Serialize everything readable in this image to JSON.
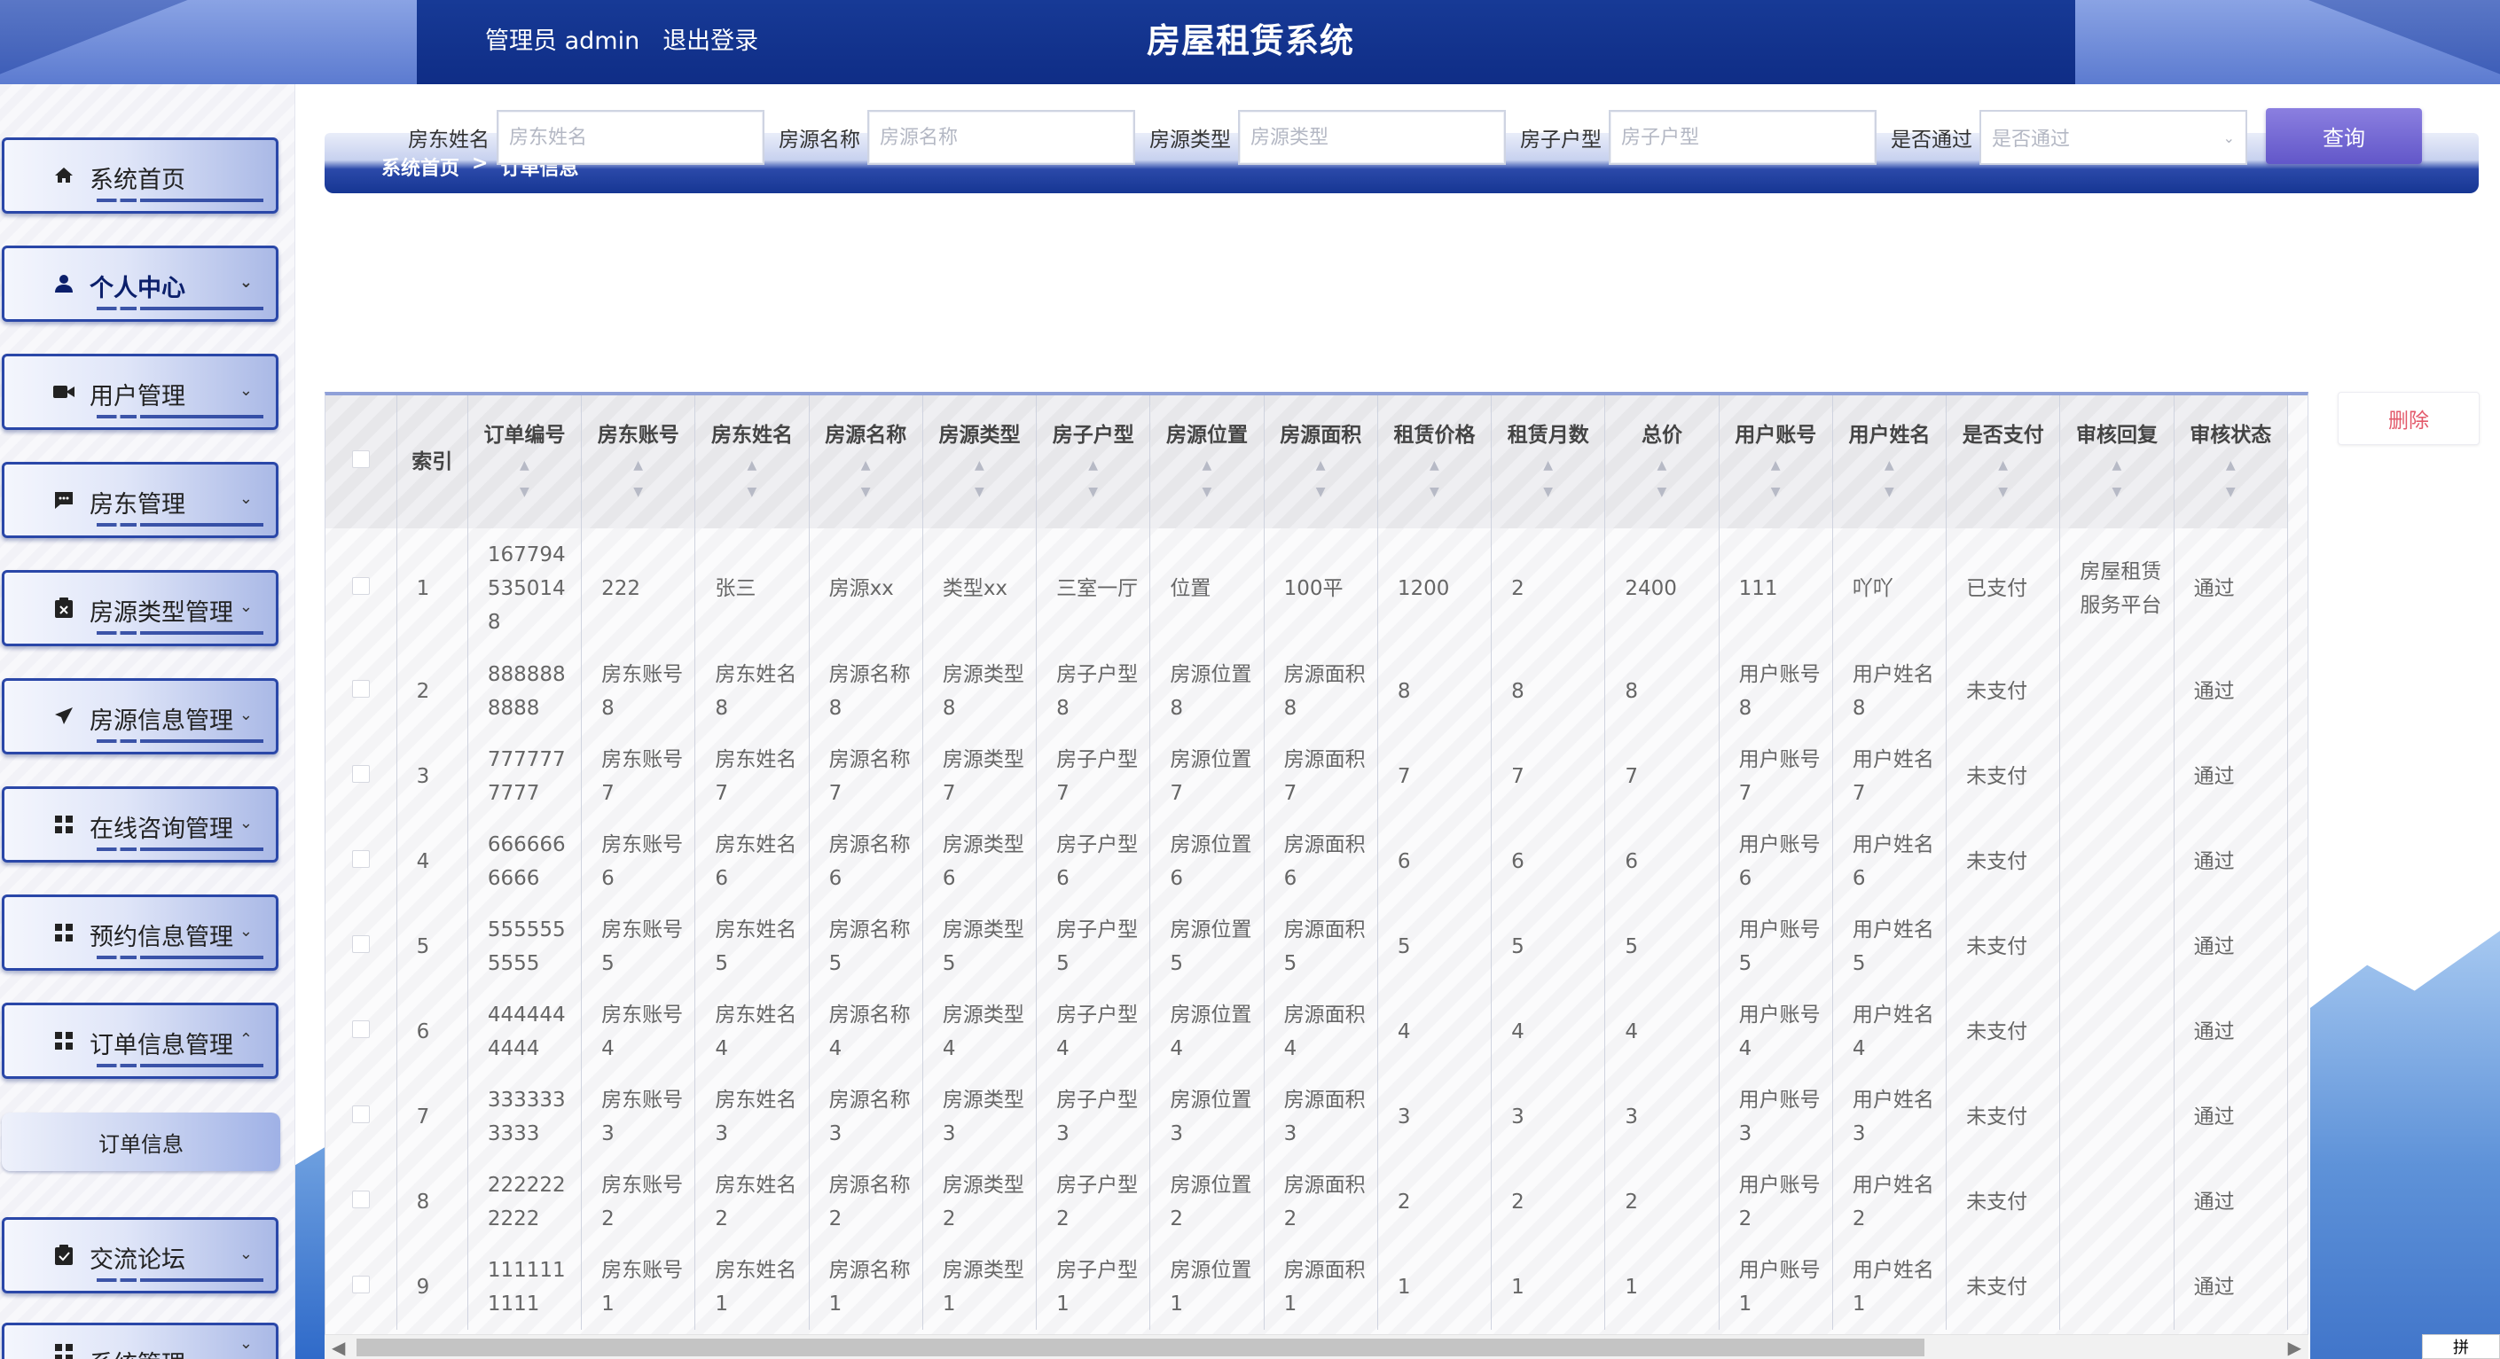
{
  "header": {
    "admin_text": "管理员 admin",
    "logout": "退出登录",
    "title": "房屋租赁系统"
  },
  "sidebar": {
    "items": [
      {
        "label": "系统首页",
        "icon": "home-icon"
      },
      {
        "label": "个人中心",
        "icon": "user-icon"
      },
      {
        "label": "用户管理",
        "icon": "video-icon"
      },
      {
        "label": "房东管理",
        "icon": "chat-icon"
      },
      {
        "label": "房源类型管理",
        "icon": "clipboard-x-icon"
      },
      {
        "label": "房源信息管理",
        "icon": "send-icon"
      },
      {
        "label": "在线咨询管理",
        "icon": "grid-icon"
      },
      {
        "label": "预约信息管理",
        "icon": "grid-icon"
      },
      {
        "label": "订单信息管理",
        "icon": "grid-icon"
      },
      {
        "label": "交流论坛",
        "icon": "clipboard-check-icon"
      },
      {
        "label": "系统管理",
        "icon": "grid-icon"
      }
    ],
    "sub_item": "订单信息"
  },
  "breadcrumb": {
    "home": "系统首页",
    "sep": ">",
    "current": "订单信息"
  },
  "search": {
    "fields": [
      {
        "label": "房东姓名",
        "placeholder": "房东姓名"
      },
      {
        "label": "房源名称",
        "placeholder": "房源名称"
      },
      {
        "label": "房源类型",
        "placeholder": "房源类型"
      },
      {
        "label": "房子户型",
        "placeholder": "房子户型"
      }
    ],
    "select": {
      "label": "是否通过",
      "placeholder": "是否通过"
    },
    "button": "查询"
  },
  "actions": {
    "delete": "删除"
  },
  "table": {
    "headers": [
      "索引",
      "订单编号",
      "房东账号",
      "房东姓名",
      "房源名称",
      "房源类型",
      "房子户型",
      "房源位置",
      "房源面积",
      "租赁价格",
      "租赁月数",
      "总价",
      "用户账号",
      "用户姓名",
      "是否支付",
      "审核回复",
      "审核状态"
    ],
    "rows": [
      [
        "1",
        "1677945350148",
        "222",
        "张三",
        "房源xx",
        "类型xx",
        "三室一厅",
        "位置",
        "100平",
        "1200",
        "2",
        "2400",
        "111",
        "吖吖",
        "已支付",
        "房屋租赁服务平台",
        "通过"
      ],
      [
        "2",
        "8888888888",
        "房东账号8",
        "房东姓名8",
        "房源名称8",
        "房源类型8",
        "房子户型8",
        "房源位置8",
        "房源面积8",
        "8",
        "8",
        "8",
        "用户账号8",
        "用户姓名8",
        "未支付",
        "",
        "通过"
      ],
      [
        "3",
        "7777777777",
        "房东账号7",
        "房东姓名7",
        "房源名称7",
        "房源类型7",
        "房子户型7",
        "房源位置7",
        "房源面积7",
        "7",
        "7",
        "7",
        "用户账号7",
        "用户姓名7",
        "未支付",
        "",
        "通过"
      ],
      [
        "4",
        "6666666666",
        "房东账号6",
        "房东姓名6",
        "房源名称6",
        "房源类型6",
        "房子户型6",
        "房源位置6",
        "房源面积6",
        "6",
        "6",
        "6",
        "用户账号6",
        "用户姓名6",
        "未支付",
        "",
        "通过"
      ],
      [
        "5",
        "5555555555",
        "房东账号5",
        "房东姓名5",
        "房源名称5",
        "房源类型5",
        "房子户型5",
        "房源位置5",
        "房源面积5",
        "5",
        "5",
        "5",
        "用户账号5",
        "用户姓名5",
        "未支付",
        "",
        "通过"
      ],
      [
        "6",
        "4444444444",
        "房东账号4",
        "房东姓名4",
        "房源名称4",
        "房源类型4",
        "房子户型4",
        "房源位置4",
        "房源面积4",
        "4",
        "4",
        "4",
        "用户账号4",
        "用户姓名4",
        "未支付",
        "",
        "通过"
      ],
      [
        "7",
        "3333333333",
        "房东账号3",
        "房东姓名3",
        "房源名称3",
        "房源类型3",
        "房子户型3",
        "房源位置3",
        "房源面积3",
        "3",
        "3",
        "3",
        "用户账号3",
        "用户姓名3",
        "未支付",
        "",
        "通过"
      ],
      [
        "8",
        "2222222222",
        "房东账号2",
        "房东姓名2",
        "房源名称2",
        "房源类型2",
        "房子户型2",
        "房源位置2",
        "房源面积2",
        "2",
        "2",
        "2",
        "用户账号2",
        "用户姓名2",
        "未支付",
        "",
        "通过"
      ],
      [
        "9",
        "1111111111",
        "房东账号1",
        "房东姓名1",
        "房源名称1",
        "房源类型1",
        "房子户型1",
        "房源位置1",
        "房源面积1",
        "1",
        "1",
        "1",
        "用户账号1",
        "用户姓名1",
        "未支付",
        "",
        "通过"
      ]
    ]
  },
  "ime": "拼"
}
